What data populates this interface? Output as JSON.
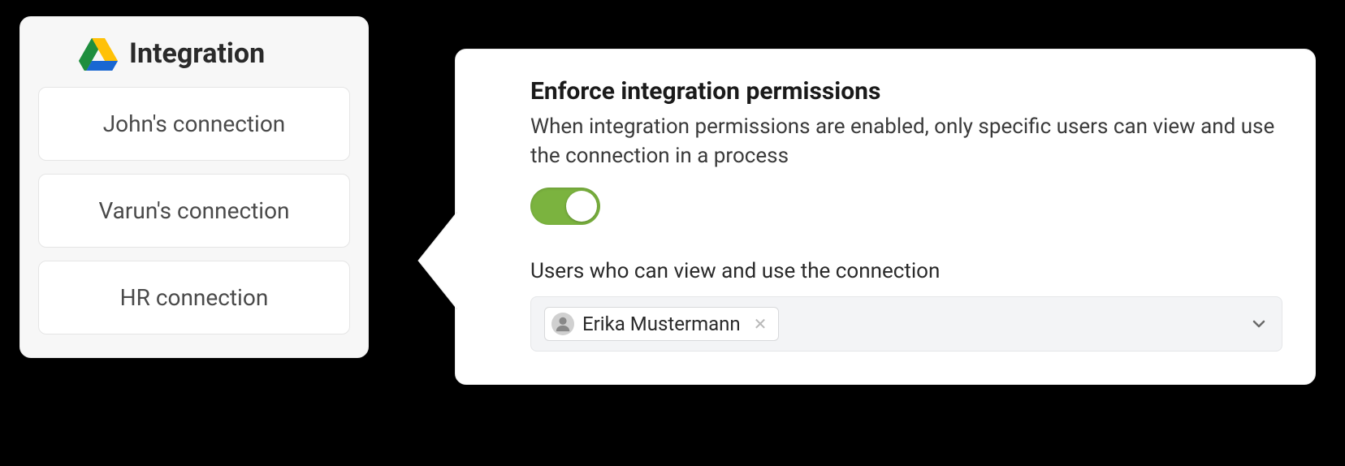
{
  "integration": {
    "title": "Integration",
    "connections": [
      {
        "label": "John's connection"
      },
      {
        "label": "Varun's connection"
      },
      {
        "label": "HR connection"
      }
    ]
  },
  "permissions": {
    "title": "Enforce integration permissions",
    "description": "When integration permissions are enabled, only specific users can view and use the connection in a process",
    "toggle_enabled": true,
    "users_label": "Users who can view and use the connection",
    "selected_users": [
      {
        "name": "Erika Mustermann"
      }
    ]
  }
}
